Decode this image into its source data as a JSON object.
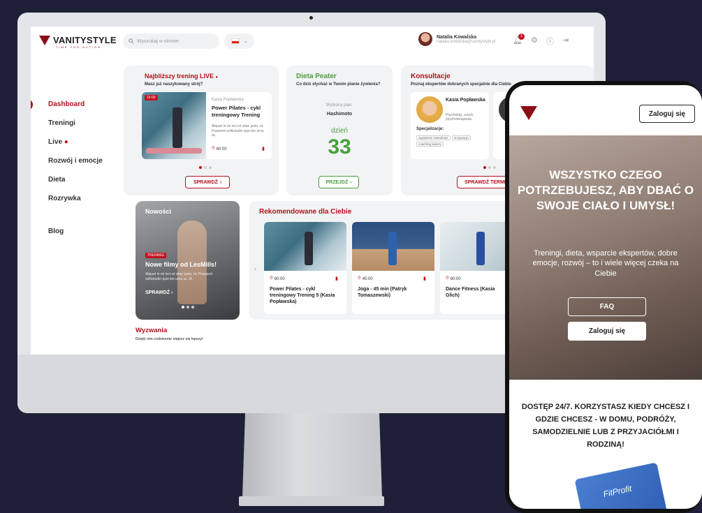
{
  "app": {
    "logo_text": "VANITYSTYLE",
    "logo_tagline": "TIME FOR ACTION"
  },
  "header": {
    "search_placeholder": "Wyszukaj w stronie",
    "user_name": "Natalia Kowalska",
    "user_email": "natalia.kowalska@vanitystyle.pl",
    "notification_count": "1"
  },
  "sidebar": {
    "items": [
      {
        "label": "Dashboard",
        "active": true
      },
      {
        "label": "Treningi"
      },
      {
        "label": "Live"
      },
      {
        "label": "Rozwój i emocje"
      },
      {
        "label": "Dieta"
      },
      {
        "label": "Rozrywka"
      },
      {
        "label": "Blog"
      }
    ]
  },
  "live": {
    "title": "Najbliższy trening LIVE",
    "subtitle": "Masz już naszykowany strój?",
    "time_tag": "16:00",
    "trainer": "Kasia Popławska",
    "name": "Power Pilates - cykl treningowy Trening",
    "desc": "Aliquet in mi orci et vitae justo, et. Praesent sollicitudin quis leo urna ac.",
    "duration": "60:00",
    "button": "SPRAWDŹ"
  },
  "diet": {
    "title": "Dieta Peater",
    "subtitle": "Co dziś słychać w Twoim planie żywienia?",
    "plan_label": "Wybrany plan:",
    "plan": "Hashimoto",
    "day_label": "dzień",
    "day": "33",
    "button": "PRZEJDŹ"
  },
  "consult": {
    "title": "Konsultacje",
    "subtitle": "Poznaj ekspertów dobranych specjalnie dla Ciebie",
    "name": "Kasia Popławska",
    "role": "Psycholog, coach, psychoterapeuta",
    "spec_label": "Specjalizacje:",
    "tags": [
      "wypalenie zawodowe",
      "motywacja",
      "coaching kariery"
    ],
    "button": "SPRAWDŹ TERMINY"
  },
  "news": {
    "title": "Nowości",
    "tag": "TRENINGI",
    "headline": "Nowe filmy od LesMills!",
    "desc": "Aliquet in mi orci et vitae justo, et. Praesent sollicitudin quis leo urna ac. M",
    "button": "SPRAWDŹ"
  },
  "recommended": {
    "title": "Rekomendowane dla Ciebie",
    "items": [
      {
        "duration": "60:00",
        "name": "Power Pilates - cykl treningowy Trening 5 (Kasia Popławska)"
      },
      {
        "duration": "45:00",
        "name": "Joga - 45 min (Patryk Tomaszewski)"
      },
      {
        "duration": "60:00",
        "name": "Dance Fitness (Kasia Glich)"
      }
    ]
  },
  "challenges": {
    "title": "Wyzwania",
    "subtitle": "Dzięki nim codziennie stajesz się lepszy!"
  },
  "phone": {
    "login_top": "Zaloguj się",
    "hero_title": "WSZYSTKO CZEGO POTRZEBUJESZ, ABY DBAĆ O SWOJE CIAŁO I UMYSŁ!",
    "hero_sub": "Treningi, dieta, wsparcie ekspertów, dobre emocje, rozwój – to i wiele więcej czeka na Ciebie",
    "faq": "FAQ",
    "login": "Zaloguj się",
    "bottom": "DOSTĘP 24/7. KORZYSTASZ KIEDY CHCESZ I GDZIE CHCESZ - W DOMU, PODRÓŻY, SAMODZIELNIE LUB Z PRZYJACIÓŁMI I RODZINĄ!",
    "card_brand": "FitProfit"
  },
  "colors": {
    "accent": "#b3101c",
    "green": "#4a9e3f",
    "background": "#1d2036"
  }
}
